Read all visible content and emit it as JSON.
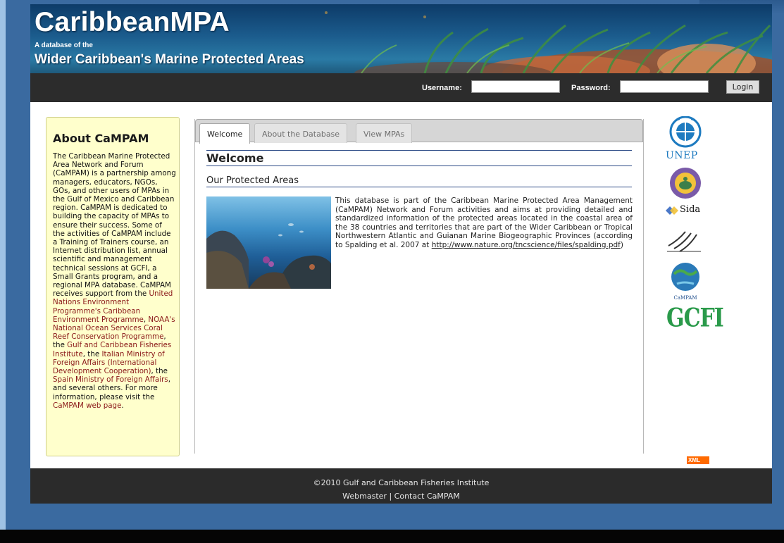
{
  "banner": {
    "title": "CaribbeanMPA",
    "tagline": "A database of the",
    "subtitle": "Wider Caribbean's Marine Protected Areas"
  },
  "login": {
    "username_label": "Username:",
    "password_label": "Password:",
    "username_value": "",
    "password_value": "",
    "login_button": "Login"
  },
  "sidebar": {
    "heading": "About CaMPAM",
    "text_1": "The Caribbean Marine Protected Area Network and Forum (CaMPAM) is a partnership among managers, educators, NGOs, GOs, and other users of MPAs in the Gulf of Mexico and Caribbean region. CaMPAM is dedicated to building the capacity of MPAs to ensure their success. Some of the activities of CaMPAM include a Training of Trainers course, an Internet distribution list, annual scientific and management technical sessions at GCFI, a Small Grants program, and a regional MPA database. CaMPAM receives support from the ",
    "link_1": "United Nations Environment Programme's Caribbean Environment Programme",
    "text_2": ", ",
    "link_2": "NOAA's National Ocean Services Coral Reef Conservation Programme",
    "text_3": ", the ",
    "link_3": "Gulf and Caribbean Fisheries Institute",
    "text_4": ", the ",
    "link_4": "Italian Ministry of Foreign Affairs (International Development Cooperation)",
    "text_5": ", the ",
    "link_5": "Spain Ministry of Foreign Affairs",
    "text_6": ", and several others. For more information, please visit the ",
    "link_6": "CaMPAM web page",
    "text_7": "."
  },
  "tabs": [
    {
      "label": "Welcome",
      "active": true
    },
    {
      "label": "About the Database",
      "active": false
    },
    {
      "label": "View MPAs",
      "active": false
    }
  ],
  "main": {
    "heading": "Welcome",
    "subheading": "Our Protected Areas",
    "body": "This database is part of the Caribbean Marine Protected Area Management (CaMPAM) Network and Forum activities and aims at providing detailed and standardized information of the protected areas located in the coastal area of the 38 countries and territories that are part of the Wider Caribbean or Tropical Northwestern Atlantic and Guianan Marine Biogeographic Provinces (according to Spalding et al. 2007 at ",
    "link": "http://www.nature.org/tncscience/files/spalding.pdf",
    "body_end": ")"
  },
  "partners": {
    "unep": "UNEP",
    "sida": "Sida",
    "campam": "CaMPAM",
    "gcfi": "GCFI"
  },
  "xml_badge": "XML",
  "footer": {
    "copyright": "©2010 Gulf and Caribbean Fisheries Institute",
    "webmaster": "Webmaster",
    "separator": " | ",
    "contact": "Contact CaMPAM"
  },
  "colors": {
    "link": "#8a1818",
    "sidebar_bg": "#ffffcc",
    "bar_bg": "#2c2c2c",
    "rule": "#2b4a86"
  }
}
